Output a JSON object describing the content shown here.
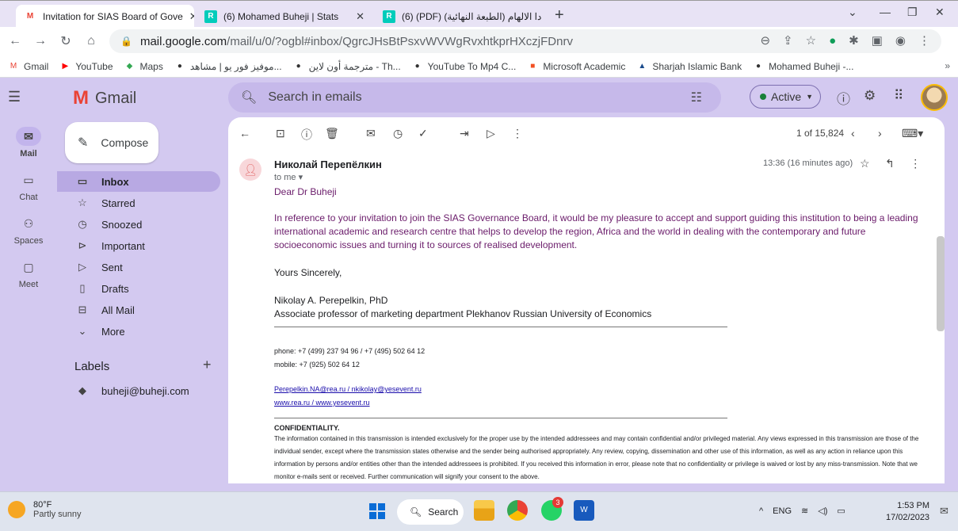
{
  "browser": {
    "tabs": [
      {
        "label": "Invitation for SIAS Board of Gove",
        "favicon": "M",
        "active": true
      },
      {
        "label": "(6) Mohamed Buheji | Stats",
        "favicon": "R",
        "active": false
      },
      {
        "label": "(6) (PDF) (الطبعة النهائية) دا الالهام",
        "favicon": "R",
        "active": false
      }
    ],
    "url_domain": "mail.google.com",
    "url_path": "/mail/u/0/?ogbl#inbox/QgrcJHsBtPsxvWVWgRvxhtkprHXczjFDnrv",
    "bookmarks": [
      {
        "label": "Gmail",
        "icon": "gmail-icon",
        "color": "#ea4335"
      },
      {
        "label": "YouTube",
        "icon": "youtube-icon",
        "color": "#ff0000"
      },
      {
        "label": "Maps",
        "icon": "maps-icon",
        "color": "#34a853"
      },
      {
        "label": "موفيز فور يو | مشاهد...",
        "icon": "site-icon",
        "color": "#333333"
      },
      {
        "label": "مترجمة أون لاين - Th...",
        "icon": "site-icon",
        "color": "#333333"
      },
      {
        "label": "YouTube To Mp4 C...",
        "icon": "site-icon",
        "color": "#333333"
      },
      {
        "label": "Microsoft Academic",
        "icon": "microsoft-icon",
        "color": "#f25022"
      },
      {
        "label": "Sharjah Islamic Bank",
        "icon": "bank-icon",
        "color": "#1a4b8c"
      },
      {
        "label": "Mohamed Buheji -...",
        "icon": "site-icon",
        "color": "#333333"
      }
    ]
  },
  "gmail": {
    "logo_text": "Gmail",
    "search_placeholder": "Search in emails",
    "status": "Active",
    "rail": [
      {
        "label": "Mail",
        "icon": "mail-icon"
      },
      {
        "label": "Chat",
        "icon": "chat-icon"
      },
      {
        "label": "Spaces",
        "icon": "spaces-icon"
      },
      {
        "label": "Meet",
        "icon": "meet-icon"
      }
    ],
    "compose_label": "Compose",
    "nav": [
      {
        "label": "Inbox",
        "icon": "inbox-icon"
      },
      {
        "label": "Starred",
        "icon": "star-icon"
      },
      {
        "label": "Snoozed",
        "icon": "clock-icon"
      },
      {
        "label": "Important",
        "icon": "important-icon"
      },
      {
        "label": "Sent",
        "icon": "send-icon"
      },
      {
        "label": "Drafts",
        "icon": "draft-icon"
      },
      {
        "label": "All Mail",
        "icon": "all-mail-icon"
      },
      {
        "label": "More",
        "icon": "chevron-down-icon"
      }
    ],
    "labels_title": "Labels",
    "labels": [
      {
        "label": "buheji@buheji.com",
        "icon": "label-icon"
      }
    ],
    "pager": "1 of 15,824"
  },
  "message": {
    "sender": "Николай Перепёлкин",
    "to": "to me",
    "time": "13:36 (16 minutes ago)",
    "greeting": "Dear Dr Buheji",
    "paragraph": "In reference to your invitation to join the SIAS Governance Board, it would be my pleasure to accept and support guiding this institution to being a leading international academic and research centre that helps to develop the region, Africa and the world in dealing with the contemporary and future socioeconomic issues and turning it to sources of realised development.",
    "closing": "Yours Sincerely,",
    "sig_name": "Nikolay A. Perepelkin, PhD",
    "sig_title": "Associate professor of marketing department Plekhanov Russian University of Economics",
    "phone": "phone:  +7 (499) 237 94 96 / +7 (495) 502 64 12",
    "mobile": "mobile:  +7 (925) 502 64 12",
    "emails": "Perepelkin.NA@rea.ru / nkikolay@yesevent.ru",
    "websites": "www.rea.ru / www.yesevent.ru",
    "conf_title": "CONFIDENTIALITY.",
    "conf_text": "The information contained in this transmission is intended exclusively for the proper use by the intended addressees and may contain confidential and/or privileged material. Any views expressed in this transmission are those of the individual sender, except where the transmission states otherwise and the sender being authorised appropriately. Any review, copying, dissemination and other use of this information, as well as any action in reliance upon this information by persons and/or entities other than the intended addressees is prohibited. If you received this information in error, please note that no confidentiality or privilege is waived or lost by any miss-transmission. Note that we monitor e-mails sent or received. Further communication will signify your consent to the above."
  },
  "taskbar": {
    "temp": "80°F",
    "weather": "Partly sunny",
    "search_label": "Search",
    "lang": "ENG",
    "time": "1:53 PM",
    "date": "17/02/2023",
    "chrome_badge": "3"
  }
}
